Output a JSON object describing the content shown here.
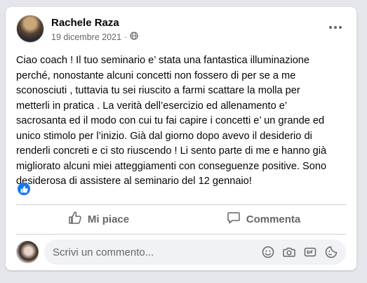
{
  "post": {
    "author": "Rachele Raza",
    "date": "19 dicembre 2021",
    "separator": "·",
    "audience_icon": "globe-icon",
    "text": "Ciao coach ! Il tuo seminario e’ stata una fantastica illuminazione\nperché, nonostante alcuni concetti non fossero di per se a me\nsconosciuti , tuttavia tu sei riuscito a farmi scattare la molla per\nmetterli in pratica . La verità dell’esercizio ed allenamento e’\nsacrosanta ed il modo con cui tu fai capire i concetti e’ un grande ed\nunico stimolo per l’inizio. Già dal giorno dopo avevo il desiderio di\nrenderli concreti e ci sto riuscendo ! Li sento parte di me e hanno già\nmigliorato alcuni miei atteggiamenti con conseguenze positive. Sono\ndesiderosa di assistere al seminario del 12 gennaio!",
    "reaction_icon": "like-reaction-icon"
  },
  "actions": {
    "like_label": "Mi piace",
    "comment_label": "Commenta"
  },
  "comment_box": {
    "placeholder": "Scrivi un commento...",
    "icons": [
      "emoji-icon",
      "camera-icon",
      "gif-icon",
      "sticker-icon"
    ]
  },
  "colors": {
    "brand_blue": "#1877f2",
    "secondary_text": "#65676b",
    "background": "#e4e6eb"
  }
}
